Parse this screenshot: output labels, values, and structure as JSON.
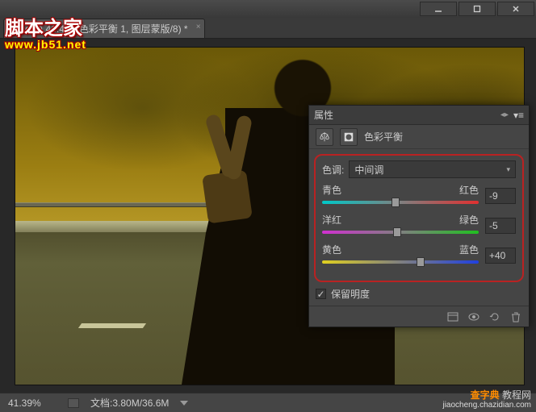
{
  "titlebar": {
    "minimize": "minimize",
    "maximize": "maximize",
    "close": "close"
  },
  "tab": {
    "label": ".psd @ 41.4% (色彩平衡 1, 图层蒙版/8) *"
  },
  "watermark": {
    "line1": "脚本之家",
    "line2": "www.jb51.net"
  },
  "panel": {
    "title": "属性",
    "adjustment_name": "色彩平衡",
    "tone_label": "色调:",
    "tone_value": "中间调",
    "sliders": [
      {
        "left": "青色",
        "right": "红色",
        "value": "-9",
        "pos": 47
      },
      {
        "left": "洋红",
        "right": "绿色",
        "value": "-5",
        "pos": 48
      },
      {
        "left": "黄色",
        "right": "蓝色",
        "value": "+40",
        "pos": 63
      }
    ],
    "preserve_luminosity": "保留明度",
    "checked": "✓"
  },
  "status": {
    "zoom": "41.39%",
    "doc_label": "文档:",
    "doc_value": "3.80M/36.6M"
  },
  "bottom_wm": {
    "line1_a": "查字典",
    "line1_b": " 教程网",
    "line2": "jiaocheng.chazidian.com"
  }
}
